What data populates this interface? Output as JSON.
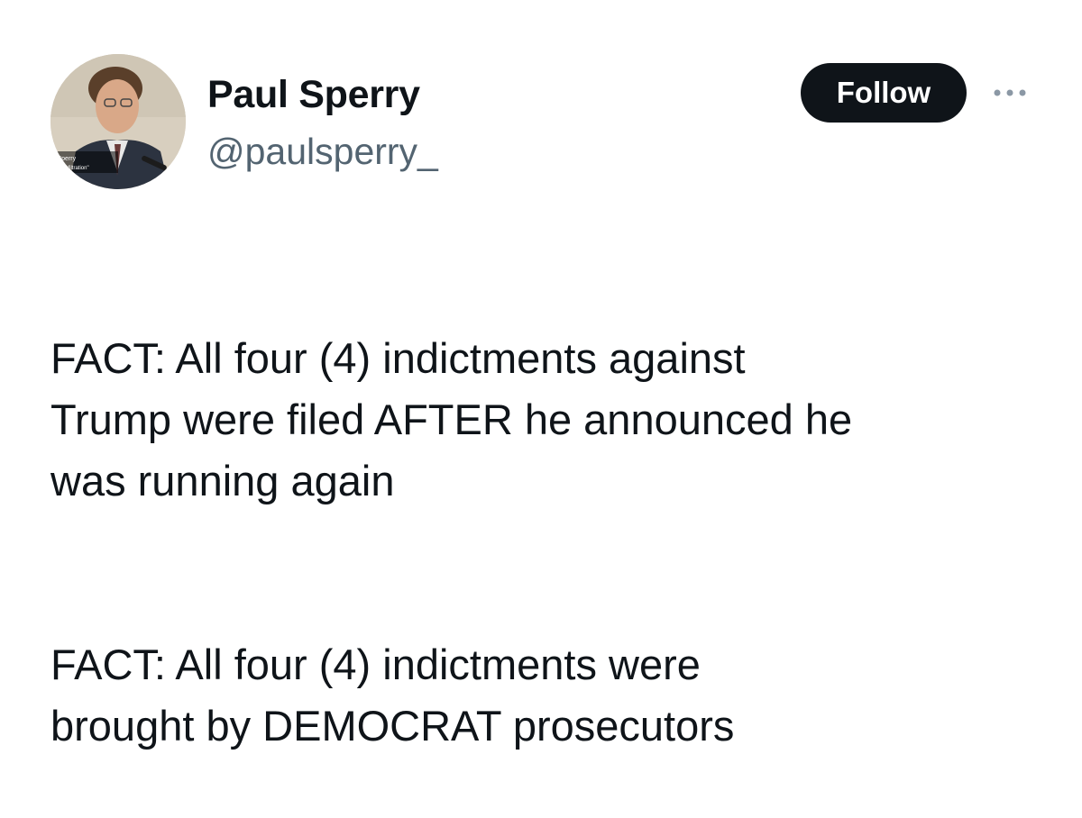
{
  "author": {
    "display_name": "Paul Sperry",
    "handle": "@paulsperry_",
    "avatar_icon": "profile-photo",
    "avatar_caption_line1": "l Sperry",
    "avatar_caption_line2": "or, \"Infiltration\""
  },
  "actions": {
    "follow_label": "Follow",
    "more_icon": "more-options-icon"
  },
  "tweet": {
    "paragraphs": [
      "FACT:  All four (4) indictments against\nTrump were filed AFTER he announced he\nwas running again",
      "FACT:  All four (4) indictments were\nbrought by DEMOCRAT prosecutors"
    ]
  },
  "colors": {
    "text_primary": "#0f1419",
    "text_secondary": "#536471",
    "button_bg": "#0f1419",
    "button_text": "#ffffff"
  }
}
